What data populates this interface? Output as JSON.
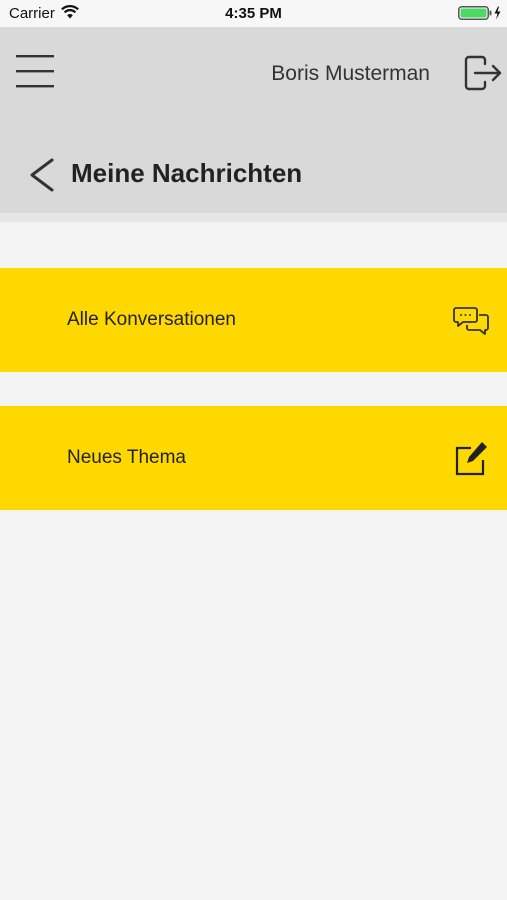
{
  "status_bar": {
    "carrier": "Carrier",
    "time": "4:35 PM",
    "wifi_icon": "wifi-icon",
    "battery_icon": "battery-charging-icon"
  },
  "header": {
    "menu_icon": "hamburger-menu-icon",
    "user_name": "Boris Musterman",
    "logout_icon": "logout-icon",
    "back_icon": "chevron-left-icon",
    "title": "Meine Nachrichten",
    "background_color": "#d9d9d9"
  },
  "menu": {
    "accent_color": "#ffd800",
    "items": [
      {
        "label": "Alle Konversationen",
        "icon": "chat-bubbles-icon"
      },
      {
        "label": "Neues Thema",
        "icon": "compose-icon"
      }
    ]
  }
}
